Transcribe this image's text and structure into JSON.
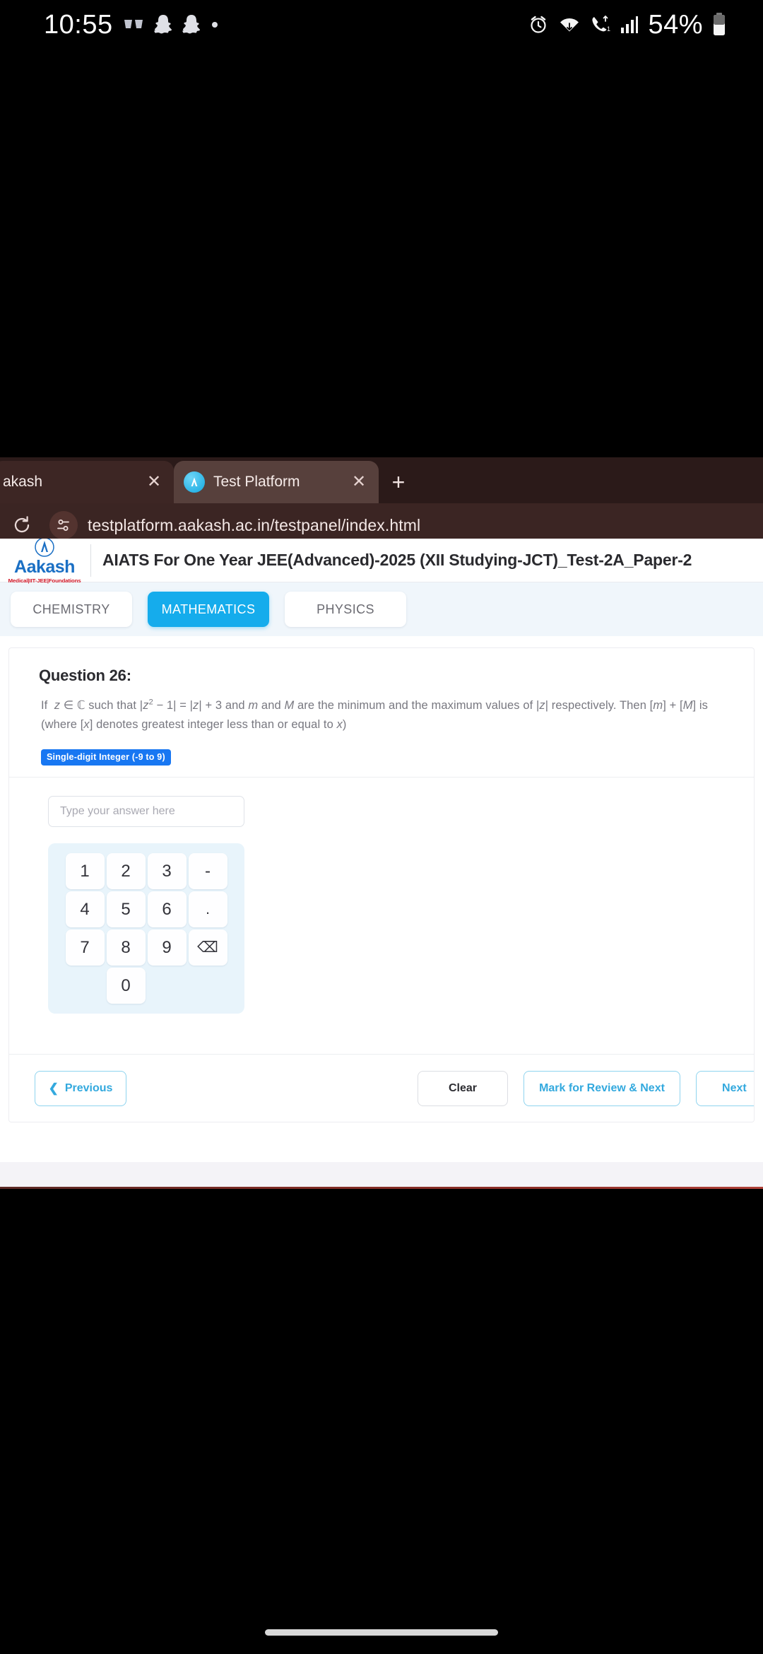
{
  "status_bar": {
    "clock": "10:55",
    "battery_percent": "54%",
    "left_icons": [
      "glasses-icon",
      "snapchat-icon",
      "snapchat-icon",
      "dot-icon"
    ],
    "right_icons": [
      "alarm-icon",
      "wifi-icon",
      "call-icon",
      "signal-icon",
      "battery-icon"
    ]
  },
  "browser": {
    "tabs": [
      {
        "title": "akash",
        "favicon": "none",
        "close_label": "✕"
      },
      {
        "title": "Test Platform",
        "favicon": "aakash-favicon",
        "close_label": "✕"
      }
    ],
    "new_tab_label": "+",
    "reload_label": "reload-icon",
    "url": "testplatform.aakash.ac.in/testpanel/index.html"
  },
  "app": {
    "brand": {
      "name": "Aakash",
      "tagline": "Medical|IIT-JEE|Foundations"
    },
    "test_title": "AIATS For One Year JEE(Advanced)-2025 (XII Studying-JCT)_Test-2A_Paper-2",
    "subjects": [
      {
        "label": "CHEMISTRY",
        "active": false
      },
      {
        "label": "MATHEMATICS",
        "active": true
      },
      {
        "label": "PHYSICS",
        "active": false
      }
    ],
    "accent_color": "#15acec",
    "badge_color": "#1877f2",
    "question": {
      "number_label": "Question 26:",
      "text": "If z ∈ ℂ such that |z² − 1| = |z| + 3 and m and M are the minimum and the maximum values of |z| respectively. Then [m] + [M] is (where [x] denotes greatest integer less than or equal to x)",
      "type_badge": "Single-digit Integer (-9 to 9)"
    },
    "answer": {
      "value": "",
      "placeholder": "Type your answer here"
    },
    "keypad": [
      "1",
      "2",
      "3",
      "-",
      "4",
      "5",
      "6",
      ".",
      "7",
      "8",
      "9",
      "⌫",
      "",
      "0",
      "",
      ""
    ],
    "footer": {
      "previous": "Previous",
      "clear": "Clear",
      "mark_for_review": "Mark for Review & Next",
      "next": "Next"
    }
  }
}
